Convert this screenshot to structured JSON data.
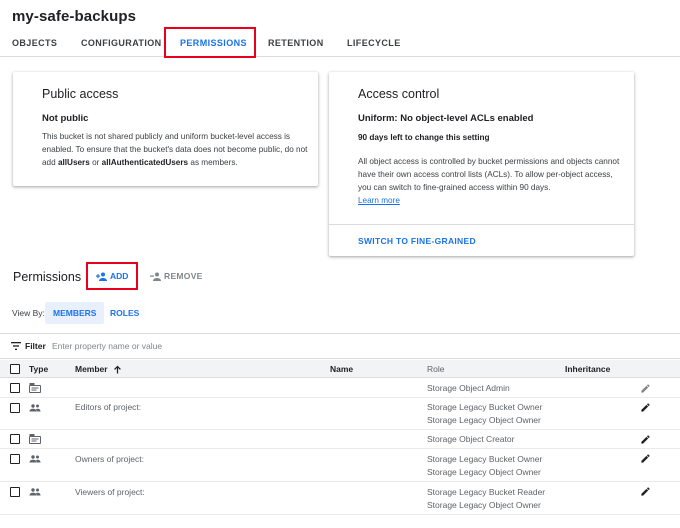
{
  "header": {
    "title": "my-safe-backups"
  },
  "tabs": [
    {
      "label": "OBJECTS"
    },
    {
      "label": "CONFIGURATION"
    },
    {
      "label": "PERMISSIONS"
    },
    {
      "label": "RETENTION"
    },
    {
      "label": "LIFECYCLE"
    }
  ],
  "active_tab": "PERMISSIONS",
  "public_access": {
    "title": "Public access",
    "status": "Not public",
    "text_a": "This bucket is not shared publicly and uniform bucket-level access is enabled. To ensure that the bucket's data does not become public, do not add ",
    "all_users": "allUsers",
    "text_b": " or ",
    "all_auth": "allAuthenticatedUsers",
    "text_c": " as members."
  },
  "access_control": {
    "title": "Access control",
    "status": "Uniform: No object-level ACLs enabled",
    "days_left": "90 days left to change this setting",
    "description": "All object access is controlled by bucket permissions and objects cannot have their own access control lists (ACLs). To allow per-object access, you can switch to fine-grained access within 90 days.",
    "learn_more": "Learn more",
    "switch_button": "SWITCH TO FINE-GRAINED"
  },
  "permissions": {
    "title": "Permissions",
    "add_label": "ADD",
    "remove_label": "REMOVE",
    "view_by_label": "View By:",
    "view_members": "MEMBERS",
    "view_roles": "ROLES",
    "filter_label": "Filter",
    "filter_placeholder": "Enter property name or value"
  },
  "table": {
    "columns": {
      "type": "Type",
      "member": "Member",
      "name": "Name",
      "role": "Role",
      "inheritance": "Inheritance"
    },
    "sort_icon": "arrow-up-icon",
    "rows": [
      {
        "type_icon": "service-account-icon",
        "member": "",
        "roles": [
          "Storage Object Admin"
        ]
      },
      {
        "type_icon": "group-icon",
        "member": "Editors of project:",
        "roles": [
          "Storage Legacy Bucket Owner",
          "Storage Legacy Object Owner"
        ]
      },
      {
        "type_icon": "service-account-icon",
        "member": "",
        "roles": [
          "Storage Object Creator"
        ]
      },
      {
        "type_icon": "group-icon",
        "member": "Owners of project:",
        "roles": [
          "Storage Legacy Bucket Owner",
          "Storage Legacy Object Owner"
        ]
      },
      {
        "type_icon": "group-icon",
        "member": "Viewers of project:",
        "roles": [
          "Storage Legacy Bucket Reader",
          "Storage Legacy Object Owner"
        ]
      }
    ]
  },
  "colors": {
    "accent": "#1a73e8",
    "highlight": "#e8001c"
  }
}
